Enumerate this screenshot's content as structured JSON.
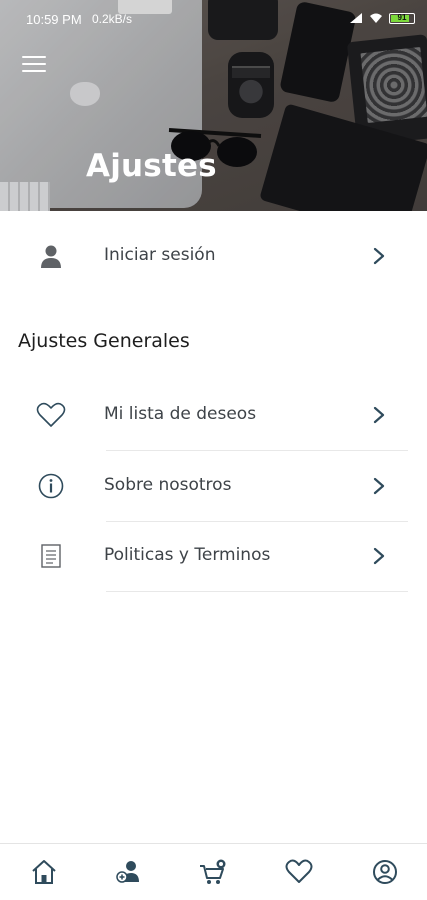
{
  "status_bar": {
    "time": "10:59 PM",
    "speed": "0.2kB/s",
    "battery": "91"
  },
  "header": {
    "title": "Ajustes",
    "menu_icon": "hamburger-menu-icon"
  },
  "login": {
    "label": "Iniciar sesión",
    "icon": "person-icon"
  },
  "general_settings": {
    "title": "Ajustes Generales",
    "items": [
      {
        "label": "Mi lista de deseos",
        "icon": "heart-outline-icon"
      },
      {
        "label": "Sobre nosotros",
        "icon": "info-circle-icon"
      },
      {
        "label": "Politicas y Terminos",
        "icon": "document-icon"
      }
    ]
  },
  "bottom_nav": {
    "items": [
      {
        "icon": "home-icon"
      },
      {
        "icon": "add-user-icon"
      },
      {
        "icon": "cart-icon"
      },
      {
        "icon": "heart-icon"
      },
      {
        "icon": "account-circle-icon"
      }
    ]
  },
  "colors": {
    "icon": "#2f4b5c",
    "text": "#3e4348",
    "divider": "#e8e8e8"
  }
}
